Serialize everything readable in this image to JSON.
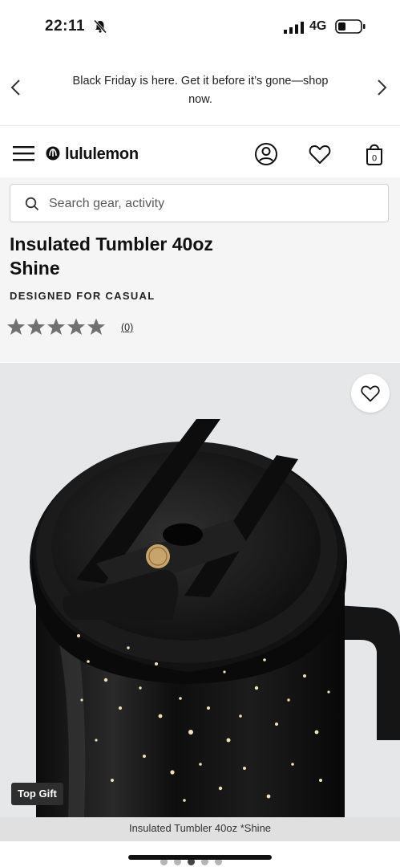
{
  "status_bar": {
    "time": "22:11",
    "network": "4G"
  },
  "promo": {
    "text": "Black Friday is here. Get it before it’s gone—shop now."
  },
  "header": {
    "brand": "lululemon",
    "bag_count": "0"
  },
  "search": {
    "placeholder": "Search gear, activity"
  },
  "product": {
    "name_line1": "Insulated Tumbler 40oz",
    "name_line2": "Shine",
    "activity": "DESIGNED FOR CASUAL",
    "rating": 0,
    "review_count": "(0)",
    "badge": "Top Gift",
    "image_caption": "Insulated Tumbler 40oz *Shine",
    "image_count": 5,
    "active_image": 2
  },
  "icons": {
    "promo_prev": "chevron-left-icon",
    "promo_next": "chevron-right-icon",
    "menu": "hamburger-menu-icon",
    "account": "user-icon",
    "wishlist": "heart-icon",
    "bag": "shopping-bag-icon",
    "search": "search-icon",
    "favorite": "heart-icon"
  },
  "colors": {
    "accent_dark": "#111111",
    "badge_bg": "#2e2e2e",
    "star_empty": "#707070"
  }
}
